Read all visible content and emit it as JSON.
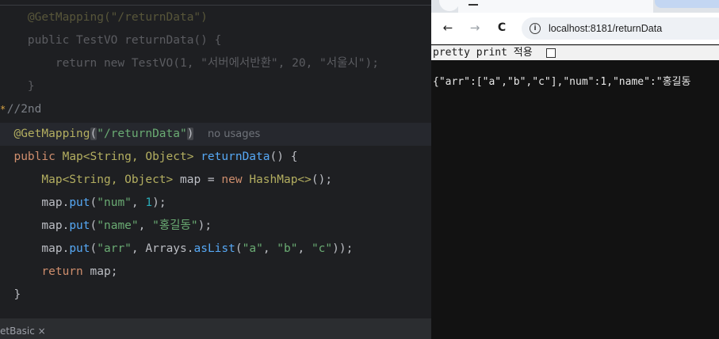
{
  "ide": {
    "code_lines": [
      {
        "id": "l1",
        "tokens": [
          {
            "t": "    @GetMapping(\"/returnData\")",
            "c": "pl"
          }
        ]
      },
      {
        "id": "l2",
        "tokens": [
          {
            "t": "    public TestVO returnData() {",
            "c": "pl"
          }
        ]
      },
      {
        "id": "l3",
        "tokens": [
          {
            "t": "        return new TestVO(1, \"서버에서반환\", 20, \"서울시\");",
            "c": "pl"
          }
        ]
      },
      {
        "id": "l4",
        "tokens": [
          {
            "t": "    }",
            "c": "pl"
          }
        ]
      },
      {
        "id": "l5",
        "tokens": [
          {
            "t": " //2nd",
            "c": "cm"
          }
        ]
      }
    ],
    "gutter_marker": "*",
    "annotation": "@GetMapping",
    "mapping_open": "(",
    "mapping_path": "\"/returnData\"",
    "mapping_close": ")",
    "usage_hint": "no usages",
    "signature": {
      "kw": "public",
      "type": "Map<String, Object>",
      "method": "returnData",
      "rest": "() {"
    },
    "line_map_decl": {
      "type": "Map<String, Object>",
      "name": " map = ",
      "kw": "new",
      "ctor": "HashMap<>",
      "end": "();"
    },
    "line_put_num": {
      "obj": "map.",
      "fn": "put",
      "open": "(",
      "key": "\"num\"",
      "sep": ", ",
      "val": "1",
      "end": ");"
    },
    "line_put_name": {
      "obj": "map.",
      "fn": "put",
      "open": "(",
      "key": "\"name\"",
      "sep": ", ",
      "val": "\"홍길동\"",
      "end": ");"
    },
    "line_put_arr": {
      "obj": "map.",
      "fn": "put",
      "open": "(",
      "key": "\"arr\"",
      "sep": ", ",
      "cls": "Arrays.",
      "fn2": "asList",
      "open2": "(",
      "a": "\"a\"",
      "s1": ", ",
      "b": "\"b\"",
      "s2": ", ",
      "c": "\"c\"",
      "end": "));"
    },
    "line_return": {
      "kw": "return",
      "rest": " map;"
    },
    "line_close": "}",
    "bottom_tab": "etBasic  ×"
  },
  "browser": {
    "url": "localhost:8181/returnData",
    "back": "←",
    "forward": "→",
    "reload": "C",
    "info": "i",
    "pretty_print_label": "pretty print 적용",
    "json_text": "{\"arr\":[\"a\",\"b\",\"c\"],\"num\":1,\"name\":\"홍길동"
  }
}
